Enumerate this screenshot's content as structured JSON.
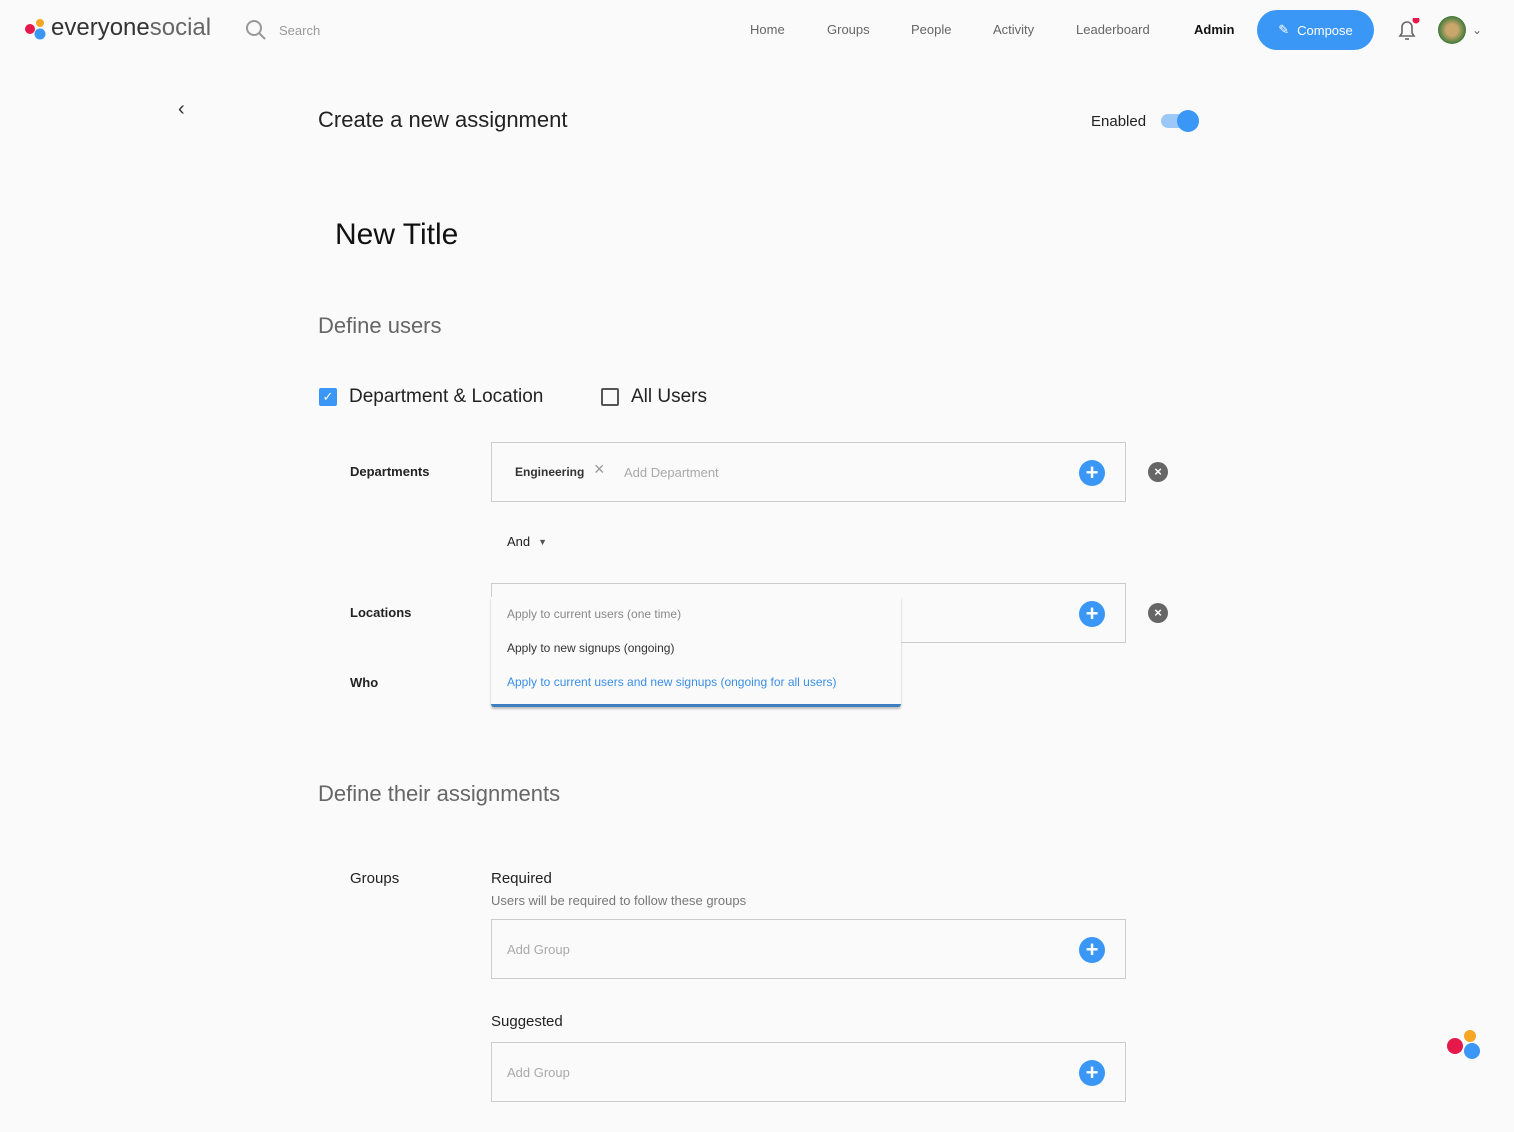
{
  "brand": {
    "name_a": "everyone",
    "name_b": "social"
  },
  "search": {
    "placeholder": "Search"
  },
  "nav": {
    "items": [
      "Home",
      "Groups",
      "People",
      "Activity",
      "Leaderboard"
    ],
    "admin": "Admin",
    "compose": "Compose"
  },
  "colors": {
    "accent": "#3a97f5",
    "notification": "#e6194b"
  },
  "page": {
    "title": "Create a new assignment",
    "enabled_label": "Enabled",
    "enabled": true,
    "assignment_title": "New Title"
  },
  "define_users": {
    "heading": "Define users",
    "dept_loc": "Department & Location",
    "dept_loc_checked": true,
    "all_users": "All Users",
    "all_users_checked": false,
    "departments_label": "Departments",
    "dept_tag": "Engineering",
    "dept_placeholder": "Add Department",
    "operator": "And",
    "locations_label": "Locations",
    "who_label": "Who",
    "who_options": [
      "Apply to current users (one time)",
      "Apply to new signups (ongoing)",
      "Apply to current users and new signups (ongoing for all users)"
    ]
  },
  "define_assignments": {
    "heading": "Define their assignments",
    "groups_label": "Groups",
    "required": "Required",
    "required_desc": "Users will be required to follow these groups",
    "required_placeholder": "Add Group",
    "suggested": "Suggested",
    "suggested_placeholder": "Add Group"
  }
}
